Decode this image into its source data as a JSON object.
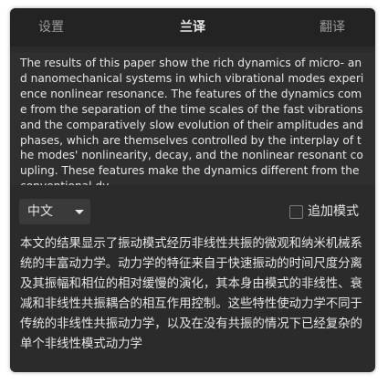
{
  "tabs": {
    "settings": "设置",
    "lanyi": "兰译",
    "fanyi": "翻译"
  },
  "source_text": "The results of this paper show the rich dynamics of micro- and nanomechanical systems in which vibrational modes experience nonlinear resonance. The features of the dynamics come from the separation of the time scales of the fast vibrations and the comparatively slow evolution of their amplitudes and phases, which are themselves controlled by the interplay of the modes' nonlinearity, decay, and the nonlinear resonant coupling. These features make the dynamics different from the conventional dy",
  "controls": {
    "language": "中文",
    "append_mode": "追加模式"
  },
  "result_text": "本文的结果显示了振动模式经历非线性共振的微观和纳米机械系统的丰富动力学。动力学的特征来自于快速振动的时间尺度分离及其振幅和相位的相对缓慢的演化，其本身由模式的非线性、衰减和非线性共振耦合的相互作用控制。这些特性使动力学不同于传统的非线性共振动力学，以及在没有共振的情况下已经复杂的单个非线性模式动力学"
}
